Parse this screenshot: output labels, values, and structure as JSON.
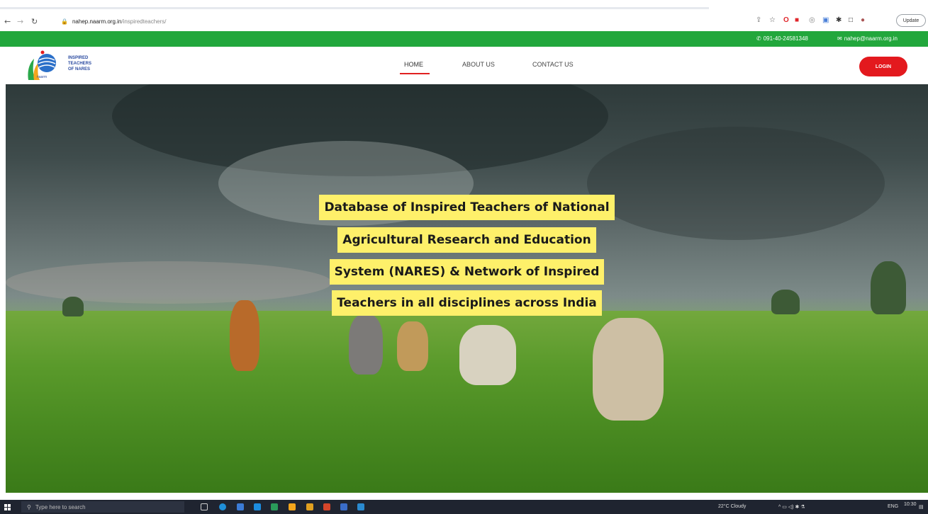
{
  "browser": {
    "url_host": "nahep.naarm.org.in",
    "url_path": "/inspiredteachers/",
    "update_label": "Update"
  },
  "topbar": {
    "phone": "091-40-24581348",
    "email": "nahep@naarm.org.in"
  },
  "header": {
    "logo_text_1": "INSPIRED",
    "logo_text_2": "TEACHERS",
    "logo_text_3": "OF NARES",
    "logo_sub": "naarm",
    "nav": [
      "HOME",
      "ABOUT US",
      "CONTACT US"
    ],
    "login_label": "LOGIN"
  },
  "hero": {
    "lines": [
      "Database of Inspired Teachers of National",
      "Agricultural Research and Education",
      "System (NARES) & Network of Inspired",
      "Teachers in all disciplines across India"
    ]
  },
  "taskbar": {
    "search_placeholder": "Type here to search",
    "weather": "22°C  Cloudy",
    "lang": "ENG",
    "time": "10:30"
  }
}
